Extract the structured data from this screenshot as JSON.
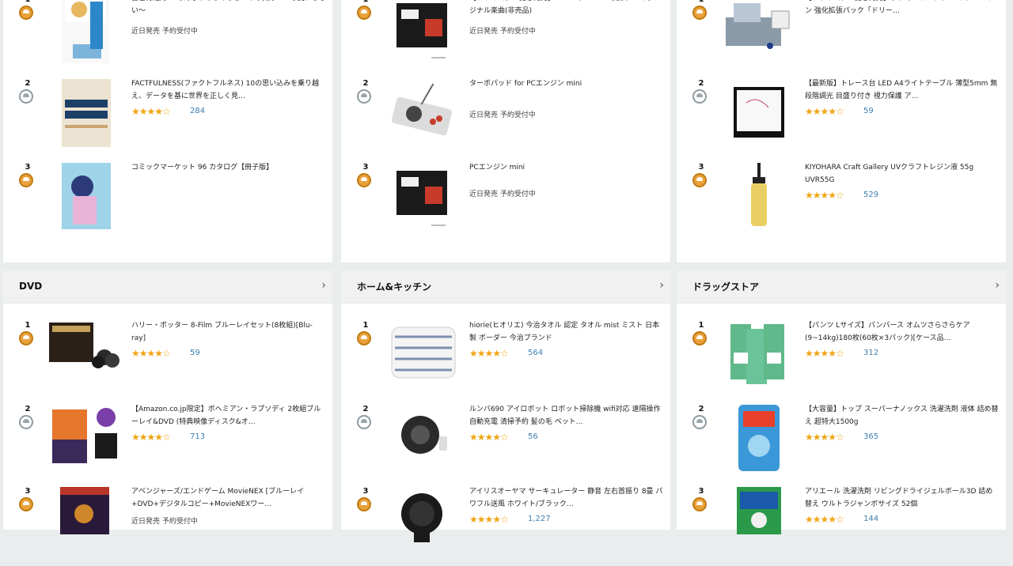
{
  "sections": [
    {
      "header": "",
      "items": [
        {
          "rank": "1",
          "medal": "gold",
          "title": "自己肯定力 〜そんなこともあるさ…やる気はいつも変わらない〜",
          "meta": "近日発売 予約受付中",
          "stars": "",
          "reviews": ""
        },
        {
          "rank": "2",
          "medal": "silver",
          "title": "FACTFULNESS(ファクトフルネス) 10の思い込みを乗り越え、データを基に世界を正しく見…",
          "meta": "",
          "stars": "★★★★☆",
          "reviews": "284"
        },
        {
          "rank": "3",
          "medal": "gold",
          "title": "コミックマーケット 96 カタログ【冊子版】",
          "meta": "",
          "stars": "",
          "reviews": ""
        }
      ]
    },
    {
      "header": "",
      "items": [
        {
          "rank": "1",
          "medal": "gold",
          "title": "【プライムデー記念発売】PCエンジン mini収録ゲームオリジナル楽曲(非売品)",
          "meta": "近日発売 予約受付中",
          "stars": "",
          "reviews": ""
        },
        {
          "rank": "2",
          "medal": "silver",
          "title": "ターボパッド for PCエンジン mini",
          "meta": "近日発売 予約受付中",
          "stars": "",
          "reviews": ""
        },
        {
          "rank": "3",
          "medal": "gold",
          "title": "PCエンジン mini",
          "meta": "近日発売 予約受付中",
          "stars": "",
          "reviews": ""
        }
      ]
    },
    {
      "header": "",
      "items": [
        {
          "rank": "1",
          "medal": "gold",
          "title": "【プライムデー記念発売】ポケモンカードゲーム サン&ムーン 強化拡張パック「ドリー…",
          "meta": "",
          "stars": "",
          "reviews": ""
        },
        {
          "rank": "2",
          "medal": "silver",
          "title": "【最新版】トレース台 LED A4ライトテーブル 薄型5mm 無段階調光 目盛り付き 視力保護 ア…",
          "meta": "",
          "stars": "★★★★☆",
          "reviews": "59"
        },
        {
          "rank": "3",
          "medal": "gold",
          "title": "KIYOHARA Craft Gallery UVクラフトレジン液 55g UVR55G",
          "meta": "",
          "stars": "★★★★☆",
          "reviews": "529"
        }
      ]
    },
    {
      "header": "DVD",
      "items": [
        {
          "rank": "1",
          "medal": "gold",
          "title": "ハリー・ポッター 8-Film ブルーレイセット(8枚組)[Blu-ray]",
          "meta": "",
          "stars": "★★★★☆",
          "reviews": "59"
        },
        {
          "rank": "2",
          "medal": "silver",
          "title": "【Amazon.co.jp限定】ボヘミアン・ラプソディ 2枚組ブルーレイ&DVD (特典映像ディスク&オ…",
          "meta": "",
          "stars": "★★★★☆",
          "reviews": "713"
        },
        {
          "rank": "3",
          "medal": "gold",
          "title": "アベンジャーズ/エンドゲーム MovieNEX [ブルーレイ+DVD+デジタルコピー+MovieNEXワー…",
          "meta": "近日発売 予約受付中",
          "stars": "",
          "reviews": ""
        }
      ]
    },
    {
      "header": "ホーム&キッチン",
      "items": [
        {
          "rank": "1",
          "medal": "gold",
          "title": "hiorie(ヒオリエ) 今治タオル 認定 タオル mist ミスト 日本製 ボーダー 今治ブランド",
          "meta": "",
          "stars": "★★★★☆",
          "reviews": "564"
        },
        {
          "rank": "2",
          "medal": "silver",
          "title": "ルンバ690 アイロボット ロボット掃除機 wifi対応 遠隔操作 自動充電 清掃予約 髪の毛 ペット…",
          "meta": "",
          "stars": "★★★★☆",
          "reviews": "56"
        },
        {
          "rank": "3",
          "medal": "gold",
          "title": "アイリスオーヤマ サーキュレーター 静音 左右首振り 8畳 パワフル送風 ホワイト/ブラック…",
          "meta": "",
          "stars": "★★★★☆",
          "reviews": "1,227"
        }
      ]
    },
    {
      "header": "ドラッグストア",
      "items": [
        {
          "rank": "1",
          "medal": "gold",
          "title": "【パンツ Lサイズ】パンパース オムツさらさらケア (9~14kg)180枚(60枚×3パック)[ケース品…",
          "meta": "",
          "stars": "★★★★☆",
          "reviews": "312"
        },
        {
          "rank": "2",
          "medal": "silver",
          "title": "【大容量】トップ スーパーナノックス 洗濯洗剤 液体 詰め替え 超特大1500g",
          "meta": "",
          "stars": "★★★★☆",
          "reviews": "365"
        },
        {
          "rank": "3",
          "medal": "gold",
          "title": "アリエール 洗濯洗剤 リビングドライジェルボール3D 詰め替え ウルトラジャンボサイズ 52個",
          "meta": "",
          "stars": "★★★★☆",
          "reviews": "144"
        }
      ]
    }
  ],
  "chevron": "›"
}
